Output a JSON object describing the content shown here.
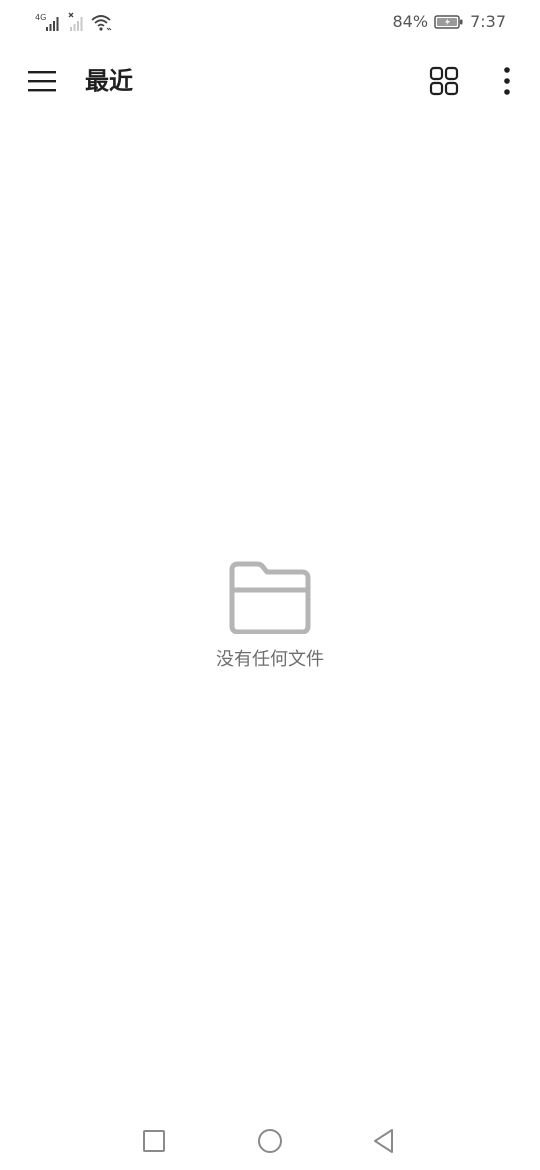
{
  "status_bar": {
    "network_label": "4G",
    "signal_icon": "signal-bars-icon",
    "no_sim_icon": "no-signal-icon",
    "wifi_icon": "wifi-icon",
    "battery_percent": "84%",
    "battery_icon": "battery-charging-icon",
    "time": "7:37"
  },
  "app_bar": {
    "menu_icon": "hamburger-menu-icon",
    "title": "最近",
    "grid_icon": "grid-view-icon",
    "more_icon": "more-vert-icon"
  },
  "empty_state": {
    "icon": "folder-icon",
    "message": "没有任何文件"
  },
  "nav_bar": {
    "recents_icon": "square-recents-icon",
    "home_icon": "circle-home-icon",
    "back_icon": "triangle-back-icon"
  },
  "colors": {
    "background": "#ffffff",
    "icon_gray": "#b5b5b5",
    "text_gray": "#6e6e6e",
    "title_dark": "#1f1f1f"
  }
}
